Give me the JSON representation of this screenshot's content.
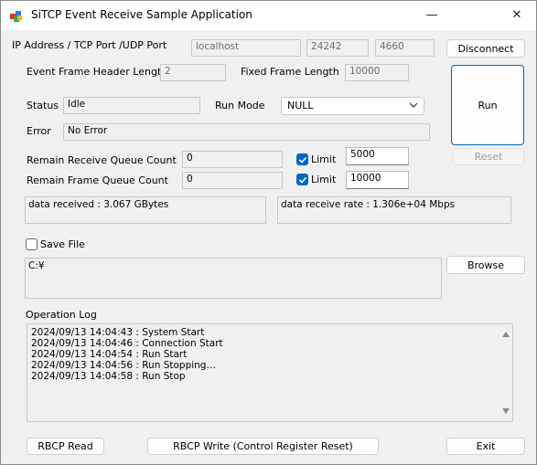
{
  "window": {
    "title": "SiTCP Event Receive Sample Application",
    "minimize_glyph": "—",
    "close_glyph": "✕"
  },
  "connection": {
    "label": "IP Address / TCP Port /UDP Port",
    "ip": "localhost",
    "tcp_port": "24242",
    "udp_port": "4660",
    "disconnect_label": "Disconnect"
  },
  "frame": {
    "header_length_label": "Event Frame Header Length",
    "header_length_value": "2",
    "fixed_length_label": "Fixed Frame Length",
    "fixed_length_value": "10000"
  },
  "run": {
    "run_label": "Run",
    "reset_label": "Reset"
  },
  "status": {
    "label": "Status",
    "value": "Idle",
    "run_mode_label": "Run Mode",
    "run_mode_value": "NULL",
    "error_label": "Error",
    "error_value": "No Error"
  },
  "queues": {
    "receive_label": "Remain Receive Queue Count",
    "receive_value": "0",
    "receive_limit_label": "Limit",
    "receive_limit_checked": true,
    "receive_limit_value": "5000",
    "frame_label": "Remain Frame Queue Count",
    "frame_value": "0",
    "frame_limit_label": "Limit",
    "frame_limit_checked": true,
    "frame_limit_value": "10000"
  },
  "stats": {
    "received": "data received : 3.067 GBytes",
    "rate": "data receive rate : 1.306e+04 Mbps"
  },
  "save": {
    "label": "Save File",
    "checked": false,
    "path": "C:¥",
    "browse_label": "Browse"
  },
  "log": {
    "label": "Operation Log",
    "lines": [
      "2024/09/13 14:04:43 : System Start",
      "2024/09/13 14:04:46 : Connection Start",
      "2024/09/13 14:04:54 : Run Start",
      "2024/09/13 14:04:56 : Run Stopping…",
      "2024/09/13 14:04:58 : Run Stop"
    ]
  },
  "footer": {
    "rbcp_read_label": "RBCP Read",
    "rbcp_write_label": "RBCP Write (Control Register Reset)",
    "exit_label": "Exit"
  },
  "colors": {
    "accent": "#0067c0",
    "window_bg": "#f0f0f0"
  }
}
